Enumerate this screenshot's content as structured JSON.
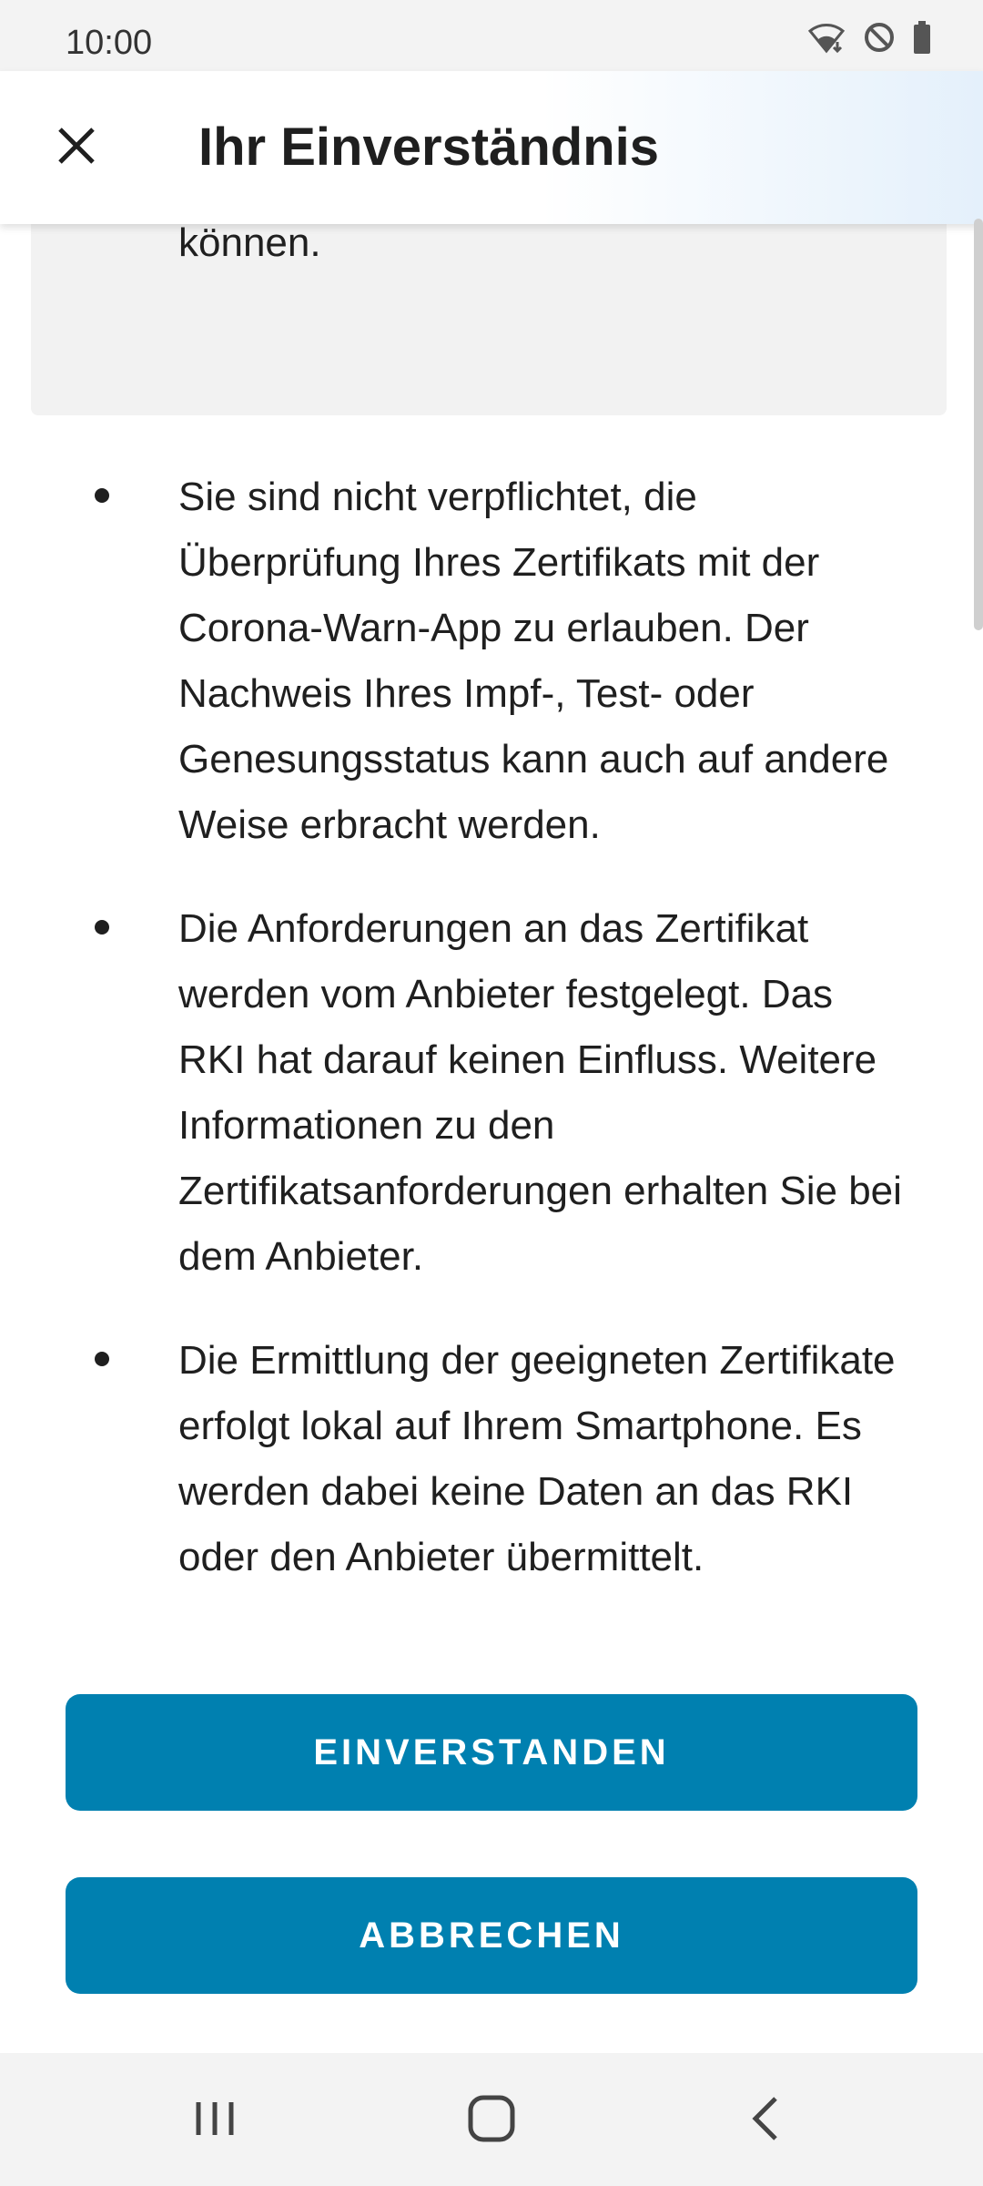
{
  "status_bar": {
    "time": "10:00",
    "icons": [
      "wifi-icon",
      "do-not-disturb-icon",
      "battery-icon"
    ]
  },
  "header": {
    "title": "Ihr Einverständnis",
    "close_icon": "close-icon"
  },
  "content": {
    "gray_box_text": "können.",
    "bullets": [
      "Sie sind nicht verpflichtet, die Überprüfung Ihres Zertifikats mit der Corona-Warn-App zu erlauben. Der Nachweis Ihres Impf-, Test- oder Genesungsstatus kann auch auf andere Weise erbracht werden.",
      "Die Anforderungen an das Zertifikat werden vom Anbieter festgelegt. Das RKI hat darauf keinen Einfluss. Weitere Informationen zu den Zertifikatsanforderungen erhalten Sie bei dem Anbieter.",
      "Die Ermittlung der geeigneten Zertifikate erfolgt lokal auf Ihrem Smartphone. Es werden dabei keine Daten an das RKI oder den Anbieter übermittelt."
    ]
  },
  "buttons": {
    "agree_label": "EINVERSTANDEN",
    "cancel_label": "ABBRECHEN"
  },
  "nav_bar": {
    "icons": [
      "recent-apps-icon",
      "home-icon",
      "back-icon"
    ]
  },
  "colors": {
    "primary": "#0080b0",
    "header_gradient_end": "#e4f0fb",
    "gray_box": "#f2f2f2"
  }
}
